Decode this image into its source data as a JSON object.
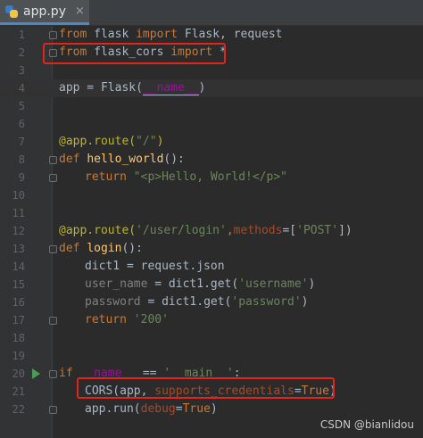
{
  "tab": {
    "filename": "app.py",
    "close_glyph": "×"
  },
  "lines": [
    {
      "n": "1"
    },
    {
      "n": "2"
    },
    {
      "n": "3"
    },
    {
      "n": "4"
    },
    {
      "n": "5"
    },
    {
      "n": "6"
    },
    {
      "n": "7"
    },
    {
      "n": "8"
    },
    {
      "n": "9"
    },
    {
      "n": "10"
    },
    {
      "n": "11"
    },
    {
      "n": "12"
    },
    {
      "n": "13"
    },
    {
      "n": "14"
    },
    {
      "n": "15"
    },
    {
      "n": "16"
    },
    {
      "n": "17"
    },
    {
      "n": "18"
    },
    {
      "n": "19"
    },
    {
      "n": "20"
    },
    {
      "n": "21"
    },
    {
      "n": "22"
    }
  ],
  "code": {
    "l1": {
      "kw1": "from",
      "mod": " flask ",
      "kw2": "import",
      "rest": " Flask, request"
    },
    "l2": {
      "kw1": "from",
      "mod": " flask_cors ",
      "kw2": "import",
      "rest": " *"
    },
    "l4": {
      "a": "app = Flask(",
      "dunder": "__name__",
      "b": ")"
    },
    "l7": {
      "dec": "@app.route(",
      "str": "\"/\"",
      "dec2": ")"
    },
    "l8": {
      "kw": "def",
      "sp": " ",
      "fn": "hello_world",
      "rest": "():"
    },
    "l9": {
      "kw": "return",
      "sp": " ",
      "str": "\"<p>Hello, World!</p>\""
    },
    "l12": {
      "dec": "@app.route(",
      "str": "'/user/login'",
      "comma": ",",
      "param": "methods",
      "eq": "=[",
      "str2": "'POST'",
      "end": "])"
    },
    "l13": {
      "kw": "def",
      "sp": " ",
      "fn": "login",
      "rest": "():"
    },
    "l14": {
      "text": "dict1 = request.json"
    },
    "l15": {
      "gray": "user_name",
      "mid": " = dict1.get(",
      "str": "'username'",
      "end": ")"
    },
    "l16": {
      "gray": "password",
      "mid": " = dict1.get(",
      "str": "'password'",
      "end": ")"
    },
    "l17": {
      "kw": "return",
      "sp": " ",
      "str": "'200'"
    },
    "l20": {
      "kw": "if",
      "sp": " ",
      "d1": "__name__",
      "mid": " == ",
      "str": "'__main__'",
      "end": ":"
    },
    "l21": {
      "a": "CORS(app, ",
      "param": "supports_credentials",
      "eq": "=",
      "kw": "True",
      "end": ")"
    },
    "l22": {
      "a": "app.run(",
      "param": "debug",
      "eq": "=",
      "kw": "True",
      "end": ")"
    }
  },
  "watermark": "CSDN @bianlidou",
  "colors": {
    "keyword": "#cc7832",
    "string": "#6a8759",
    "function": "#ffc66d",
    "decorator": "#bbb529",
    "highlight_box": "#e0251c"
  }
}
